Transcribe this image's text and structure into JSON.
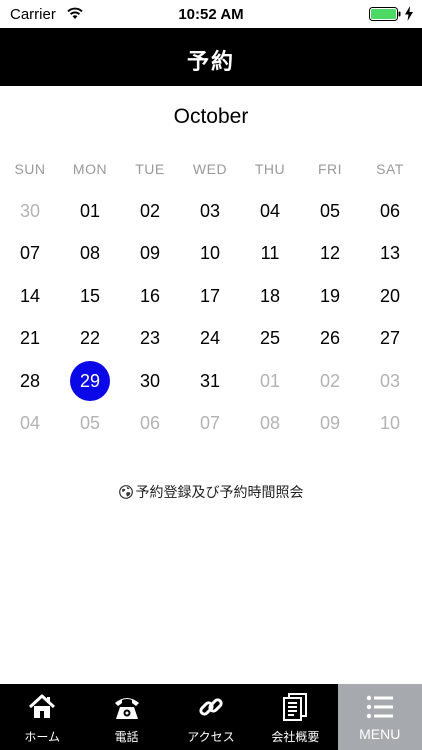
{
  "status_bar": {
    "carrier": "Carrier",
    "time": "10:52 AM"
  },
  "header": {
    "title": "予約"
  },
  "calendar": {
    "month": "October",
    "weekdays": [
      "SUN",
      "MON",
      "TUE",
      "WED",
      "THU",
      "FRI",
      "SAT"
    ],
    "selected_day": "29",
    "weeks": [
      [
        {
          "d": "30",
          "muted": true
        },
        {
          "d": "01"
        },
        {
          "d": "02"
        },
        {
          "d": "03"
        },
        {
          "d": "04"
        },
        {
          "d": "05"
        },
        {
          "d": "06"
        }
      ],
      [
        {
          "d": "07"
        },
        {
          "d": "08"
        },
        {
          "d": "09"
        },
        {
          "d": "10"
        },
        {
          "d": "11"
        },
        {
          "d": "12"
        },
        {
          "d": "13"
        }
      ],
      [
        {
          "d": "14"
        },
        {
          "d": "15"
        },
        {
          "d": "16"
        },
        {
          "d": "17"
        },
        {
          "d": "18"
        },
        {
          "d": "19"
        },
        {
          "d": "20"
        }
      ],
      [
        {
          "d": "21"
        },
        {
          "d": "22"
        },
        {
          "d": "23"
        },
        {
          "d": "24"
        },
        {
          "d": "25"
        },
        {
          "d": "26"
        },
        {
          "d": "27"
        }
      ],
      [
        {
          "d": "28"
        },
        {
          "d": "29",
          "selected": true
        },
        {
          "d": "30"
        },
        {
          "d": "31"
        },
        {
          "d": "01",
          "muted": true
        },
        {
          "d": "02",
          "muted": true
        },
        {
          "d": "03",
          "muted": true
        }
      ],
      [
        {
          "d": "04",
          "muted": true
        },
        {
          "d": "05",
          "muted": true
        },
        {
          "d": "06",
          "muted": true
        },
        {
          "d": "07",
          "muted": true
        },
        {
          "d": "08",
          "muted": true
        },
        {
          "d": "09",
          "muted": true
        },
        {
          "d": "10",
          "muted": true
        }
      ]
    ]
  },
  "reserve_link": {
    "label": "予約登録及び予約時間照会",
    "icon": "globe-icon"
  },
  "tab_bar": {
    "items": [
      {
        "label": "ホーム",
        "icon": "home-icon"
      },
      {
        "label": "電話",
        "icon": "phone-icon"
      },
      {
        "label": "アクセス",
        "icon": "link-icon"
      },
      {
        "label": "会社概要",
        "icon": "document-icon"
      },
      {
        "label": "MENU",
        "icon": "menu-icon",
        "active": true
      }
    ]
  },
  "colors": {
    "header_bg": "#000000",
    "selected_day": "#0a08e6",
    "tab_bar_bg": "#000000",
    "tab_active_bg": "#a6a9ad",
    "battery": "#4cd964"
  }
}
